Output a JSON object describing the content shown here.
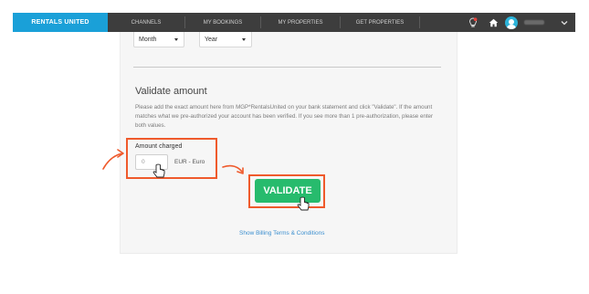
{
  "navbar": {
    "brand": "RENTALS UNITED",
    "items": [
      {
        "label": "CHANNELS"
      },
      {
        "label": "MY BOOKINGS"
      },
      {
        "label": "MY PROPERTIES"
      },
      {
        "label": "GET PROPERTIES"
      }
    ],
    "icons": [
      "lightbulb-icon",
      "home-icon",
      "avatar",
      "chevron-down-icon"
    ],
    "colors": {
      "bar": "#3d3d3d",
      "brand": "#1aa0d8"
    }
  },
  "form": {
    "month_select": "Month",
    "year_select": "Year",
    "title": "Validate amount",
    "description": "Please add the exact amount here from MGP*RentalsUnited on your bank statement and click \"Validate\". If the amount matches what we pre-authorized your account has been verified. If you see more than 1 pre-authorization, please enter both values.",
    "amount_label": "Amount charged",
    "amount_placeholder": "0",
    "currency": "EUR - Euro",
    "validate_label": "VALIDATE",
    "terms_link": "Show Billing Terms & Conditions"
  },
  "colors": {
    "highlight": "#ef5a2c",
    "button": "#27bb6d",
    "link": "#3c8fcf"
  }
}
